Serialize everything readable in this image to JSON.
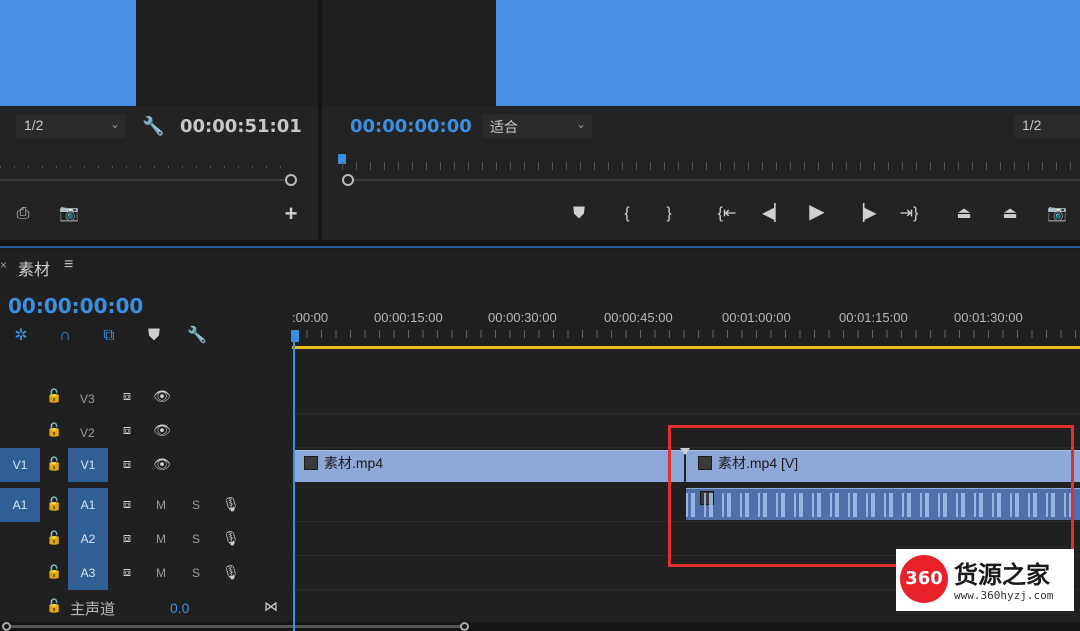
{
  "source_monitor": {
    "resolution": "1/2",
    "timecode": "00:00:51:01"
  },
  "program_monitor": {
    "timecode": "00:00:00:00",
    "fit": "适合",
    "resolution": "1/2"
  },
  "timeline": {
    "tab_label": "素材",
    "menu_icon": "≡",
    "timecode": "00:00:00:00",
    "ruler": [
      ":00:00",
      "00:00:15:00",
      "00:00:30:00",
      "00:00:45:00",
      "00:01:00:00",
      "00:01:15:00",
      "00:01:30:00"
    ],
    "tracks": [
      {
        "id": "V3",
        "type": "video"
      },
      {
        "id": "V2",
        "type": "video"
      },
      {
        "id": "V1",
        "type": "video",
        "source": "V1"
      },
      {
        "id": "A1",
        "type": "audio",
        "source": "A1",
        "m": "M",
        "s": "S"
      },
      {
        "id": "A2",
        "type": "audio",
        "m": "M",
        "s": "S"
      },
      {
        "id": "A3",
        "type": "audio",
        "m": "M",
        "s": "S"
      }
    ],
    "master": {
      "label": "主声道",
      "value": "0.0"
    },
    "clips": {
      "v1_first": "素材.mp4",
      "v1_second": "素材.mp4 [V]"
    }
  },
  "watermark": {
    "logo": "360",
    "name": "货源之家",
    "url": "www.360hyzj.com"
  },
  "colors": {
    "preview": "#4a90e6",
    "accent_blue": "#3b8fe0",
    "clip": "#8ea8d8",
    "highlight_box": "#e03030",
    "work_area": "#e8c020"
  }
}
